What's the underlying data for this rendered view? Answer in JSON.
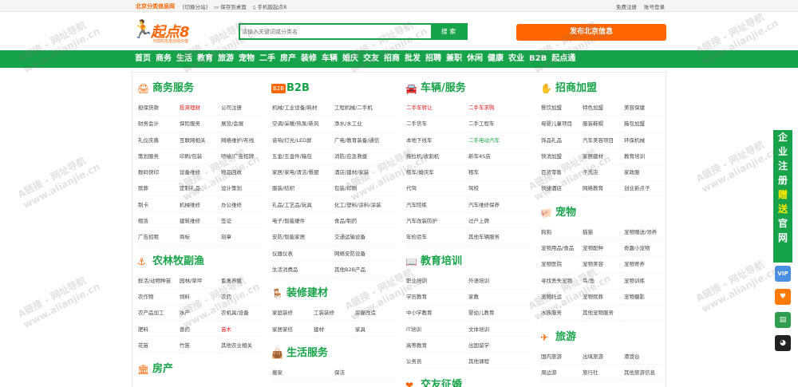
{
  "topbar": {
    "city": "北京分类信息网",
    "switch": "[切换分站]",
    "save": "保存到桌面",
    "mobile": "手机版起点8",
    "register": "免费注册",
    "login": "账号登录"
  },
  "logo": {
    "name": "起点8",
    "slogan": "为您的信息创造价值"
  },
  "search": {
    "placeholder": "请输入关键词或分类名",
    "button": "搜 索"
  },
  "publish": "发布北京信息",
  "nav": [
    "首页",
    "商务",
    "生活",
    "教育",
    "旅游",
    "宠物",
    "二手",
    "房产",
    "装修",
    "车辆",
    "婚庆",
    "交友",
    "招商",
    "批发",
    "招聘",
    "兼职",
    "休闲",
    "健康",
    "农业",
    "B2B",
    "起点通"
  ],
  "columns": [
    {
      "sections": [
        {
          "icon": "printer-icon",
          "glyph": "🖨",
          "title": "商务服务",
          "cols": 3,
          "items": [
            {
              "t": "担保贷款"
            },
            {
              "t": "投资理财",
              "c": "red"
            },
            {
              "t": "公司注册"
            },
            {
              "t": "财务会计"
            },
            {
              "t": "保险服务"
            },
            {
              "t": "展览/会展"
            },
            {
              "t": "礼仪庆典"
            },
            {
              "t": "互联网相关"
            },
            {
              "t": "网络维护/布线"
            },
            {
              "t": "策划服务"
            },
            {
              "t": "印刷/包装"
            },
            {
              "t": "喷绘/广告招牌"
            },
            {
              "t": "数码快印"
            },
            {
              "t": "设备维修"
            },
            {
              "t": "物品回收"
            },
            {
              "t": "殡葬"
            },
            {
              "t": "定制礼品"
            },
            {
              "t": "设计策划"
            },
            {
              "t": "制卡"
            },
            {
              "t": "机械维修"
            },
            {
              "t": "办公维修"
            },
            {
              "t": "租赁"
            },
            {
              "t": "建筑维修"
            },
            {
              "t": "签证"
            },
            {
              "t": "广告招租"
            },
            {
              "t": "商标"
            },
            {
              "t": "刻章"
            }
          ]
        },
        {
          "icon": "anchor-icon",
          "glyph": "⚓",
          "title": "农林牧副渔",
          "cols": 3,
          "items": [
            {
              "t": "鲜活/动物种苗"
            },
            {
              "t": "园林/草坪"
            },
            {
              "t": "畜禽养殖"
            },
            {
              "t": "农作物"
            },
            {
              "t": "饲料"
            },
            {
              "t": "农药"
            },
            {
              "t": "农产品加工"
            },
            {
              "t": "水产"
            },
            {
              "t": "农机具/设备"
            },
            {
              "t": "肥料"
            },
            {
              "t": "兽药"
            },
            {
              "t": "苗木",
              "c": "red"
            },
            {
              "t": "花苗"
            },
            {
              "t": "竹笛"
            },
            {
              "t": "其他农业相关"
            }
          ]
        },
        {
          "icon": "house-icon",
          "glyph": "🏛",
          "title": "房产",
          "cols": 3,
          "items": []
        }
      ]
    },
    {
      "sections": [
        {
          "icon": "b2b-icon",
          "glyph": "B2B",
          "title": "B2B",
          "cols": 2,
          "items": [
            {
              "t": "机械/工业设备/耗材"
            },
            {
              "t": "工程机械/二手机"
            },
            {
              "t": "空调/采暖/热泵/新风"
            },
            {
              "t": "净水/水工业"
            },
            {
              "t": "音响/灯光/LED屏"
            },
            {
              "t": "广电/教育装备/通信"
            },
            {
              "t": "五金/五金件/箱包"
            },
            {
              "t": "消防/应急救援"
            },
            {
              "t": "家居/家电/清洁/餐厨"
            },
            {
              "t": "酒店/建材/家装"
            },
            {
              "t": "服装/纺织"
            },
            {
              "t": "包装/印刷"
            },
            {
              "t": "礼品/工艺品/玩具"
            },
            {
              "t": "化工/塑料/涂料/涂装"
            },
            {
              "t": "电子/智能硬件"
            },
            {
              "t": "食品/制药"
            },
            {
              "t": "安防/智能家居"
            },
            {
              "t": "交通运输设备"
            },
            {
              "t": "仪器仪表"
            },
            {
              "t": "网络安防设备"
            },
            {
              "t": "生活消费品"
            },
            {
              "t": "其他B2B产品"
            }
          ]
        },
        {
          "icon": "chair-icon",
          "glyph": "🪑",
          "title": "装修建材",
          "cols": 3,
          "items": [
            {
              "t": "家庭装修"
            },
            {
              "t": "工装装修"
            },
            {
              "t": "房屋改造"
            },
            {
              "t": "家居家纺"
            },
            {
              "t": "建材"
            },
            {
              "t": "家具"
            }
          ]
        },
        {
          "icon": "bag-icon",
          "glyph": "👜",
          "title": "生活服务",
          "cols": 2,
          "items": [
            {
              "t": "搬家"
            },
            {
              "t": "保洁"
            }
          ]
        }
      ]
    },
    {
      "sections": [
        {
          "icon": "car-icon",
          "glyph": "🚘",
          "title": "车辆/服务",
          "cols": 2,
          "items": [
            {
              "t": "二手车转让",
              "c": "red"
            },
            {
              "t": "二手车求购",
              "c": "red"
            },
            {
              "t": "二手货车"
            },
            {
              "t": "二手工程车"
            },
            {
              "t": "本地下线车"
            },
            {
              "t": "二手电动汽车",
              "c": "green"
            },
            {
              "t": "拖拉机/收割机"
            },
            {
              "t": "新车4S店"
            },
            {
              "t": "租车/婚庆车"
            },
            {
              "t": "租车"
            },
            {
              "t": "代驾"
            },
            {
              "t": "驾校"
            },
            {
              "t": "汽车陪练"
            },
            {
              "t": "汽车维修保养"
            },
            {
              "t": "汽车改装防护"
            },
            {
              "t": "过户上牌"
            },
            {
              "t": "年检验车"
            },
            {
              "t": "其他车辆服务"
            }
          ]
        },
        {
          "icon": "book-icon",
          "glyph": "📖",
          "title": "教育培训",
          "cols": 2,
          "items": [
            {
              "t": "职业培训"
            },
            {
              "t": "外语培训"
            },
            {
              "t": "学历教育"
            },
            {
              "t": "家教"
            },
            {
              "t": "中小学教育"
            },
            {
              "t": "婴幼儿教育"
            },
            {
              "t": "IT培训"
            },
            {
              "t": "文体培训"
            },
            {
              "t": "高等教育"
            },
            {
              "t": "出国留学"
            },
            {
              "t": "公务员"
            },
            {
              "t": "其他课程"
            }
          ]
        },
        {
          "icon": "heart-icon",
          "glyph": "❤",
          "title": "交友征婚",
          "cols": 2,
          "items": []
        }
      ]
    },
    {
      "sections": [
        {
          "icon": "hand-icon",
          "glyph": "✋",
          "title": "招商加盟",
          "cols": 3,
          "items": [
            {
              "t": "餐饮加盟"
            },
            {
              "t": "特色加盟"
            },
            {
              "t": "美容保健"
            },
            {
              "t": "母婴儿童项目"
            },
            {
              "t": "服装鞋帽"
            },
            {
              "t": "箱包加盟"
            },
            {
              "t": "饰品礼品"
            },
            {
              "t": "汽车美容项目"
            },
            {
              "t": "环保机械"
            },
            {
              "t": "快消加盟"
            },
            {
              "t": "家居建材"
            },
            {
              "t": "教育培训"
            },
            {
              "t": "百货零售"
            },
            {
              "t": "干洗店"
            },
            {
              "t": "家政服"
            },
            {
              "t": "快捷酒店"
            },
            {
              "t": "网络教育"
            },
            {
              "t": "创业新点子"
            }
          ]
        },
        {
          "icon": "pig-icon",
          "glyph": "🐖",
          "title": "宠物",
          "cols": 3,
          "items": [
            {
              "t": "狗狗"
            },
            {
              "t": "猫猫"
            },
            {
              "t": "宠物赠送/领养"
            },
            {
              "t": "宠物用品/食品"
            },
            {
              "t": "宠物配种"
            },
            {
              "t": "奇趣小宠物"
            },
            {
              "t": "宠物医院"
            },
            {
              "t": "宠物美容"
            },
            {
              "t": "宠物寄养"
            },
            {
              "t": "寻找丢失宠物"
            },
            {
              "t": "鸟/鱼"
            },
            {
              "t": "宠物训练"
            },
            {
              "t": "宠物托运"
            },
            {
              "t": "宠物殡葬"
            },
            {
              "t": "宠物摄影"
            },
            {
              "t": "水族服务"
            },
            {
              "t": "其他宠物服务"
            },
            {
              "t": ""
            }
          ]
        },
        {
          "icon": "plane-icon",
          "glyph": "✈",
          "title": "旅游",
          "cols": 3,
          "items": [
            {
              "t": "国内旅游"
            },
            {
              "t": "出境旅游"
            },
            {
              "t": "港澳台"
            },
            {
              "t": "周边游"
            },
            {
              "t": "旅行社"
            },
            {
              "t": "其他旅游信息"
            }
          ]
        }
      ]
    }
  ],
  "floatbar": {
    "chars": [
      "企",
      "业",
      "注",
      "册",
      "赠",
      "送",
      "官",
      "网"
    ]
  },
  "sideicons": [
    {
      "name": "vip-icon",
      "label": "VIP"
    },
    {
      "name": "gift-icon",
      "label": "♥"
    },
    {
      "name": "chart-icon",
      "label": "▤"
    },
    {
      "name": "qq-icon",
      "label": "◕"
    }
  ],
  "watermark": {
    "line1": "A链接 - 网址导航",
    "line2": "www.alianjie.cn"
  }
}
